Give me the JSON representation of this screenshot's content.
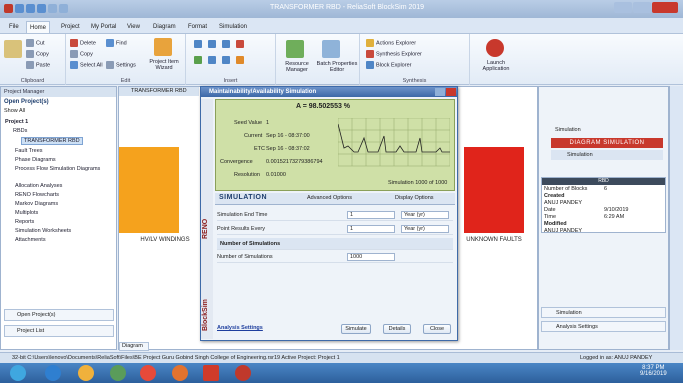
{
  "window": {
    "title": "TRANSFORMER RBD - ReliaSoft BlockSim 2019"
  },
  "menu_tabs": [
    "File",
    "Home",
    "Project",
    "My Portal",
    "View",
    "Diagram",
    "Format",
    "Simulation"
  ],
  "ribbon": {
    "clipboard": {
      "label": "Clipboard",
      "cut": "Cut",
      "copy": "Copy",
      "paste": "Paste"
    },
    "edit": {
      "label": "Edit",
      "delete": "Delete",
      "find": "Find",
      "copy2": "Copy",
      "select_all": "Select All",
      "settings": "Settings"
    },
    "project_item_wizard": "Project Item Wizard",
    "insert": {
      "label": "Insert"
    },
    "resource_manager": "Resource Manager",
    "batch_properties_editor": "Batch Properties Editor",
    "synthesis": {
      "label": "Synthesis",
      "actions_explorer": "Actions Explorer",
      "synthesis_explorer": "Synthesis Explorer",
      "block_explorer": "Block Explorer"
    },
    "launch_application": "Launch Application"
  },
  "project_manager": {
    "header": "Project Manager",
    "open_projects": "Open Project(s)",
    "show": "Show All",
    "project": "Project 1",
    "rbds": "RBDs",
    "rbd_item": "TRANSFORMER RBD",
    "items": [
      "Fault Trees",
      "Phase Diagrams",
      "Process Flow Simulation Diagrams",
      "Allocation Analyses",
      "RENO Flowcharts",
      "Markov Diagrams",
      "Multiplots",
      "Reports",
      "Simulation Worksheets",
      "Attachments"
    ],
    "open_projects_btn": "Open Project(s)",
    "project_list": "Project List"
  },
  "doc_tab": "TRANSFORMER RBD",
  "canvas": {
    "block_left": "HV/LV WINDINGS",
    "block_right": "UNKNOWN FAULTS",
    "diagram_tab": "Diagram"
  },
  "dialog": {
    "title": "Maintainability/Availability Simulation",
    "availability": "A = 98.502553 %",
    "seed_label": "Seed Value",
    "seed": "1",
    "current_label": "Current",
    "current": "Sep 16 - 08:37:00",
    "etc_label": "ETC",
    "etc": "Sep 16 - 08:37:02",
    "convergence_label": "Convergence",
    "convergence": "0.00152173279386794",
    "resolution_label": "Resolution",
    "resolution": "0.01000",
    "sim_progress": "Simulation 1000 of 1000",
    "sim_tab": "SIMULATION",
    "advanced": "Advanced Options",
    "display": "Display Options",
    "end_time_label": "Simulation End Time",
    "end_time": "1",
    "end_unit": "Year (yr)",
    "point_results_label": "Point Results Every",
    "point_results": "1",
    "point_unit": "Year (yr)",
    "num_sims_header": "Number of Simulations",
    "num_sims_label": "Number of Simulations",
    "num_sims": "1000",
    "analysis_settings": "Analysis Settings",
    "simulate": "Simulate",
    "details": "Details",
    "close": "Close",
    "side_reno": "RENO",
    "side_blocksim": "BlockSim"
  },
  "right_panel": {
    "header": "Simulation",
    "banner": "DIAGRAM SIMULATION",
    "sim_label": "Simulation",
    "table_title": "RBD",
    "rows": [
      [
        "Number of Blocks",
        "6"
      ],
      [
        "Created",
        ""
      ],
      [
        "ANUJ PANDEY",
        ""
      ],
      [
        "Date",
        "9/10/2019"
      ],
      [
        "Time",
        "6:29 AM"
      ],
      [
        "Modified",
        ""
      ],
      [
        "ANUJ PANDEY",
        ""
      ]
    ],
    "simulation_item": "Simulation",
    "analysis_settings": "Analysis Settings"
  },
  "status": {
    "path": "32-bit  C:\\Users\\lenovo\\Documents\\ReliaSoft\\Files\\BE Project Guru Gobind Singh College of Engineering.rsr19  Active Project: Project 1",
    "user": "Logged in as: ANUJ PANDEY"
  },
  "taskbar": {
    "time": "8:37 PM",
    "date": "9/16/2019"
  }
}
